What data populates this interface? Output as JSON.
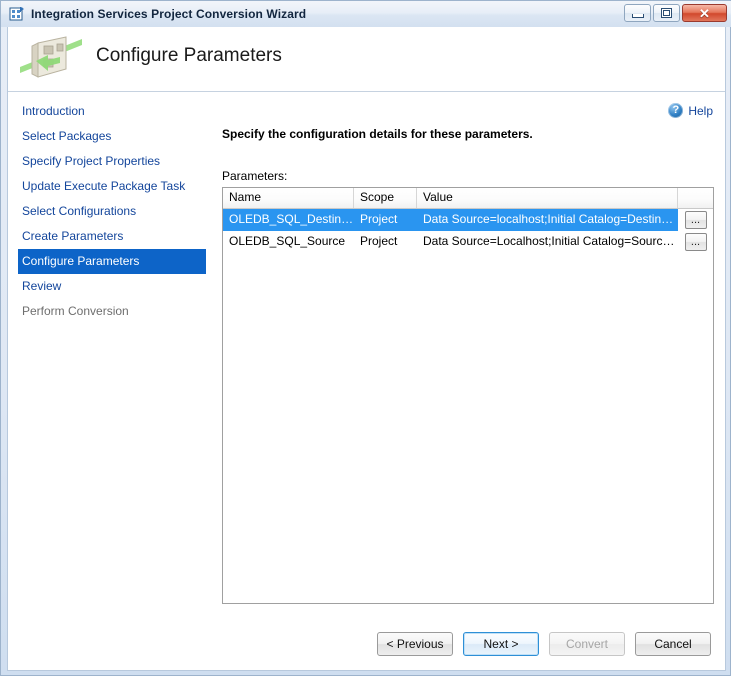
{
  "window": {
    "title": "Integration Services Project Conversion Wizard",
    "app_icon": "ssis-package-icon",
    "controls": [
      {
        "name": "minimize",
        "glyph": "minimize-icon"
      },
      {
        "name": "restore",
        "glyph": "restore-icon"
      },
      {
        "name": "close",
        "glyph": "close-icon",
        "label": "✕"
      }
    ]
  },
  "banner": {
    "icon": "conversion-wizard-icon",
    "title": "Configure Parameters"
  },
  "help": {
    "icon": "help-icon",
    "glyph": "?",
    "label": "Help"
  },
  "sidebar": {
    "items": [
      {
        "label": "Introduction",
        "state": "normal"
      },
      {
        "label": "Select Packages",
        "state": "normal"
      },
      {
        "label": "Specify Project Properties",
        "state": "normal"
      },
      {
        "label": "Update Execute Package Task",
        "state": "normal"
      },
      {
        "label": "Select Configurations",
        "state": "normal"
      },
      {
        "label": "Create Parameters",
        "state": "normal"
      },
      {
        "label": "Configure Parameters",
        "state": "active"
      },
      {
        "label": "Review",
        "state": "normal"
      },
      {
        "label": "Perform Conversion",
        "state": "disabled"
      }
    ]
  },
  "main": {
    "heading": "Specify the configuration details for these parameters.",
    "parameters_label": "Parameters:",
    "grid": {
      "columns": [
        "Name",
        "Scope",
        "Value",
        ""
      ],
      "rows": [
        {
          "name": "OLEDB_SQL_Destination",
          "scope": "Project",
          "value": "Data Source=localhost;Initial Catalog=Destination;Pro...",
          "browse_label": "...",
          "selected": true
        },
        {
          "name": "OLEDB_SQL_Source",
          "scope": "Project",
          "value": "Data Source=Localhost;Initial Catalog=Source;Provid...",
          "browse_label": "...",
          "selected": false
        }
      ]
    }
  },
  "footer": {
    "buttons": [
      {
        "label": "< Previous",
        "state": "normal"
      },
      {
        "label": "Next >",
        "state": "default"
      },
      {
        "label": "Convert",
        "state": "disabled"
      },
      {
        "label": "Cancel",
        "state": "normal"
      }
    ]
  },
  "colors": {
    "selection_blue": "#2a95f0",
    "sidebar_active": "#0d64c8",
    "link_blue": "#13459b",
    "close_red": "#d1482d"
  }
}
